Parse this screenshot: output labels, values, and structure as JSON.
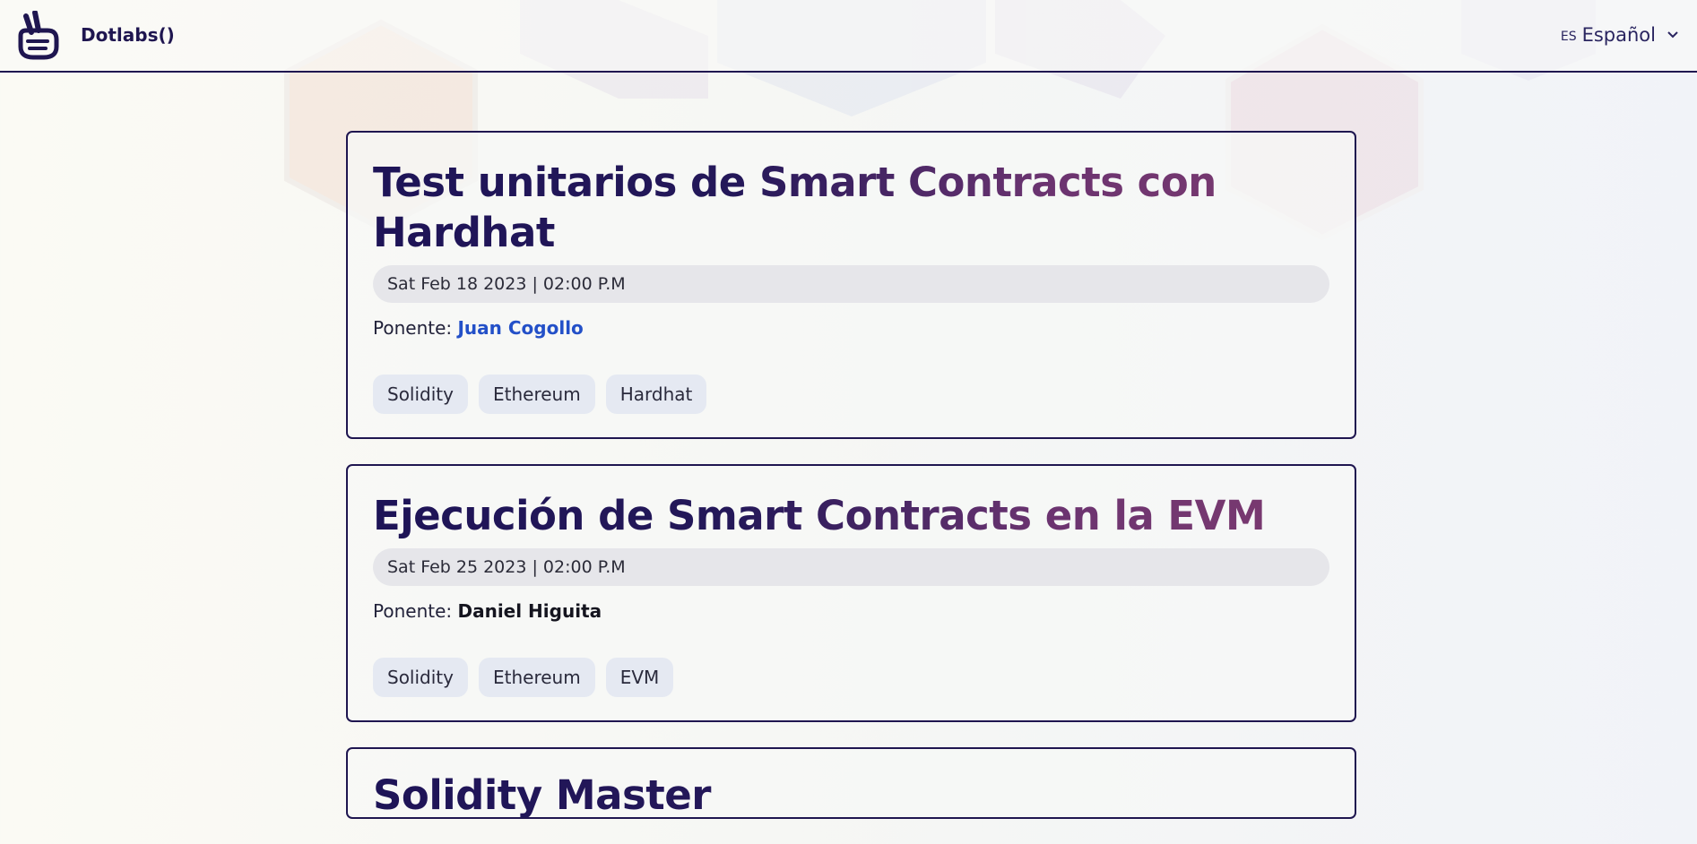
{
  "header": {
    "brand": "Dotlabs()",
    "language": {
      "code": "ES",
      "label": "Español"
    }
  },
  "events": [
    {
      "title": "Test unitarios de Smart Contracts con Hardhat",
      "date": "Sat Feb 18 2023 | 02:00 P.M",
      "speaker_label": "Ponente:",
      "speaker": "Juan Cogollo",
      "tags": [
        "Solidity",
        "Ethereum",
        "Hardhat"
      ]
    },
    {
      "title": "Ejecución de Smart Contracts en la EVM",
      "date": "Sat Feb 25 2023 | 02:00 P.M",
      "speaker_label": "Ponente:",
      "speaker": "Daniel Higuita",
      "tags": [
        "Solidity",
        "Ethereum",
        "EVM"
      ]
    },
    {
      "title": "Solidity Master"
    }
  ],
  "colors": {
    "navy": "#1f1650",
    "link": "#2350c8",
    "pill": "#e6e6ea",
    "tag": "#e5e9f2"
  }
}
